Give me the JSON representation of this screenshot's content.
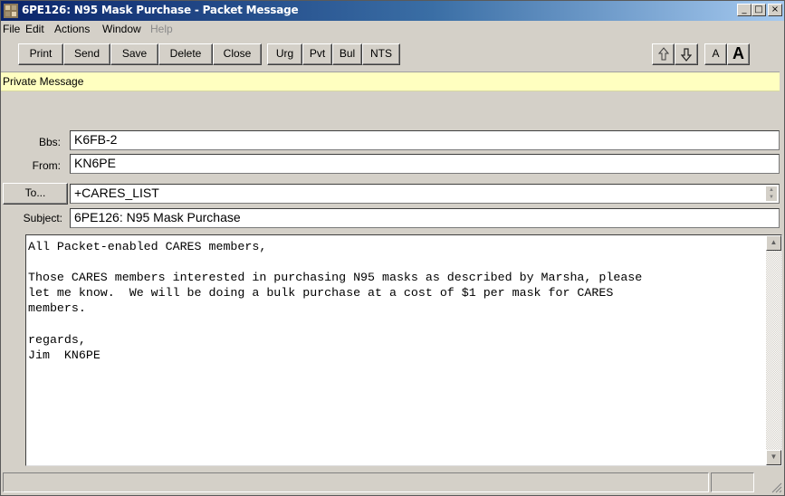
{
  "window": {
    "title": "6PE126: N95 Mask Purchase - Packet Message",
    "controls": {
      "minimize": "_",
      "maximize": "□",
      "close": "×"
    }
  },
  "menu": {
    "items": [
      {
        "label": "File",
        "enabled": true
      },
      {
        "label": "Edit",
        "enabled": true
      },
      {
        "label": "Actions",
        "enabled": true
      },
      {
        "label": "Window",
        "enabled": true
      },
      {
        "label": "Help",
        "enabled": false
      }
    ]
  },
  "toolbar": {
    "print": "Print",
    "send": "Send",
    "save": "Save",
    "delete": "Delete",
    "close": "Close",
    "urg": "Urg",
    "pvt": "Pvt",
    "bul": "Bul",
    "nts": "NTS",
    "up_icon": "arrow-up-icon",
    "down_icon": "arrow-down-icon",
    "font_small": "A",
    "font_large": "A"
  },
  "message_type": "Private Message",
  "fields": {
    "bbs": {
      "label": "Bbs:",
      "value": "K6FB-2"
    },
    "from": {
      "label": "From:",
      "value": "KN6PE"
    },
    "to": {
      "button": "To...",
      "value": "+CARES_LIST"
    },
    "subject": {
      "label": "Subject:",
      "value": "6PE126: N95 Mask Purchase"
    }
  },
  "body": {
    "text": "All Packet-enabled CARES members,\n\nThose CARES members interested in purchasing N95 masks as described by Marsha, please\nlet me know.  We will be doing a bulk purchase at a cost of $1 per mask for CARES\nmembers.\n\nregards,\nJim  KN6PE"
  },
  "colors": {
    "titlebar_start": "#0a246a",
    "titlebar_end": "#a6caf0",
    "chrome": "#d4d0c8",
    "private_bar": "#ffffc0"
  }
}
